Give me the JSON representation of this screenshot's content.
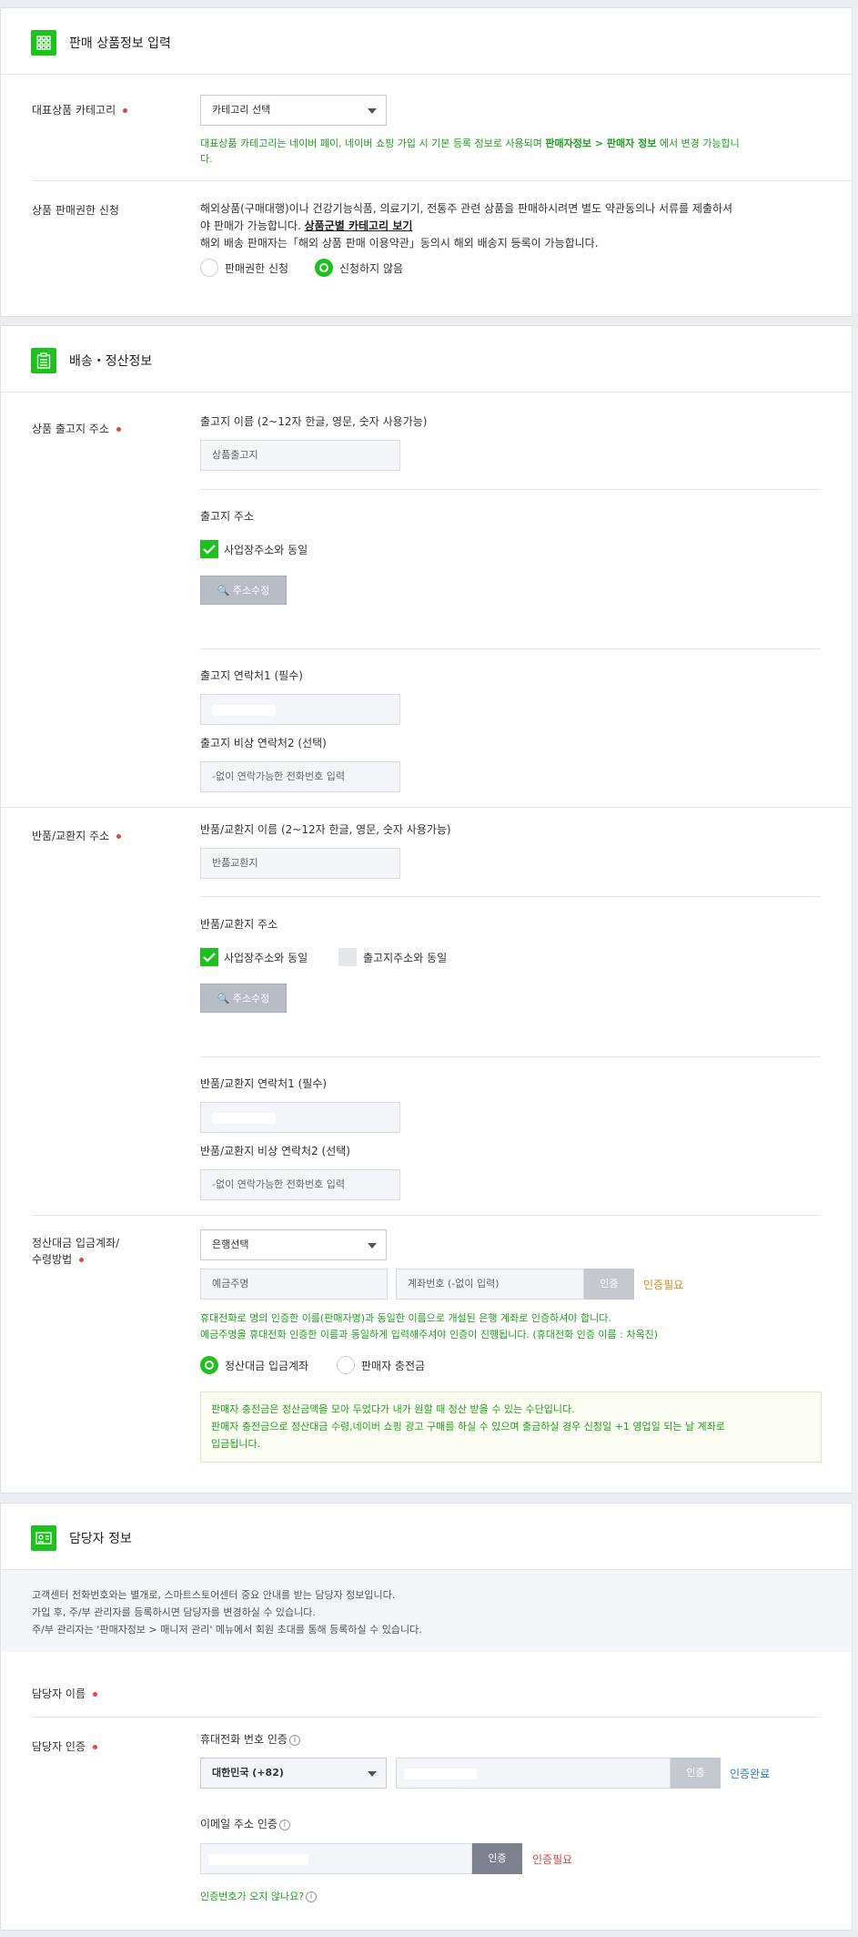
{
  "section1": {
    "title": "판매 상품정보 입력",
    "category_label": "대표상품 카테고리",
    "category_select": "카테고리 선택",
    "category_help_1": "대표상품 카테고리는 네이버 페이, 네이버 쇼핑 가입 시 기본 등록 정보로 사용되며 ",
    "category_help_bold": "판매자정보 > 판매자 정보",
    "category_help_2": " 에서 변경 가능합니",
    "category_help_3": "다.",
    "permit_label": "상품 판매권한 신청",
    "permit_desc_1": "해외상품(구매대행)이나 건강기능식품, 의료기기, 전통주 관련 상품을 판매하시려면 별도 약관동의나 서류를 제출하셔",
    "permit_desc_2": "야 판매가 가능합니다.",
    "permit_link": "상품군별 카테고리 보기",
    "permit_desc_3": "해외 배송 판매자는「해외 상품 판매 이용약관」동의시 해외 배송지 등록이 가능합니다.",
    "radio_apply": "판매권한 신청",
    "radio_not_apply": "신청하지 않음"
  },
  "section2": {
    "title": "배송・정산정보",
    "shipping_label": "상품 출고지 주소",
    "ship_name_label": "출고지 이름 (2~12자 한글, 영문, 숫자 사용가능)",
    "ship_name_value": "상품출고지",
    "ship_addr_label": "출고지 주소",
    "ship_same_business": "사업장주소와 동일",
    "address_edit_button": "주소수정",
    "ship_contact1_label": "출고지 연락처1 (필수)",
    "ship_contact2_label": "출고지 비상 연락처2 (선택)",
    "phone_placeholder": "-없이 연락가능한 전화번호 입력",
    "return_label": "반품/교환지 주소",
    "return_name_label": "반품/교환지 이름 (2~12자 한글, 영문, 숫자 사용가능)",
    "return_name_value": "반품교환지",
    "return_addr_label": "반품/교환지 주소",
    "return_same_business": "사업장주소와 동일",
    "return_same_shipping": "출고지주소와 동일",
    "return_contact1_label": "반품/교환지 연락처1 (필수)",
    "return_contact2_label": "반품/교환지 비상 연락처2 (선택)",
    "settle_label_1": "정산대금 입금계좌/",
    "settle_label_2": "수령방법",
    "bank_select": "은행선택",
    "holder_placeholder": "예금주명",
    "account_placeholder": "계좌번호 (-없이 입력)",
    "verify_button": "인증",
    "verify_needed": "인증필요",
    "settle_help_1": "휴대전화로 명의 인증한 이름(판매자명)과 동일한 이름으로 개설된 은행 계좌로 인증하셔야 합니다.",
    "settle_help_2": "예금주명을 휴대전화 인증한 이름과 동일하게 입력해주셔야 인증이 진행됩니다. (휴대전화 인증 이름 : 차옥진)",
    "radio_bank": "정산대금 입금계좌",
    "radio_charge": "판매자 충전금",
    "notice_1": "판매자 충전금은 정산금액을 모아 두었다가 내가 원할 때 정산 받을 수 있는 수단입니다.",
    "notice_2": "판매자 충전금으로 정산대금 수령,네이버 쇼핑 광고 구매를 하실 수 있으며 출금하실 경우 신청일 +1 영업일 되는 날 계좌로",
    "notice_3": "입금됩니다."
  },
  "section3": {
    "title": "담당자 정보",
    "info_1": "고객센터 전화번호와는 별개로, 스마트스토어센터 중요 안내를 받는 담당자 정보입니다.",
    "info_2": "가입 후, 주/부 관리자를 등록하시면 담당자를 변경하실 수 있습니다.",
    "info_3": "주/부 관리자는 '판매자정보 > 매니저 관리' 메뉴에서 회원 초대를 통해 등록하실 수 있습니다.",
    "manager_name_label": "담당자 이름",
    "manager_verify_label": "담당자 인증",
    "phone_verify_label": "휴대전화 번호 인증",
    "country_select": "대한민국 (+82)",
    "phone_verify_button": "인증",
    "phone_verified": "인증완료",
    "email_verify_label": "이메일 주소 인증",
    "email_verify_button": "인증",
    "email_verify_needed": "인증필요",
    "no_code_link": "인증번호가 오지 않나요?"
  },
  "colors": {
    "accent": "#1ec21e",
    "help_green": "#1ea21e",
    "warn_orange": "#d98a1a",
    "error_red": "#e24545",
    "done_blue": "#2e74c5"
  }
}
